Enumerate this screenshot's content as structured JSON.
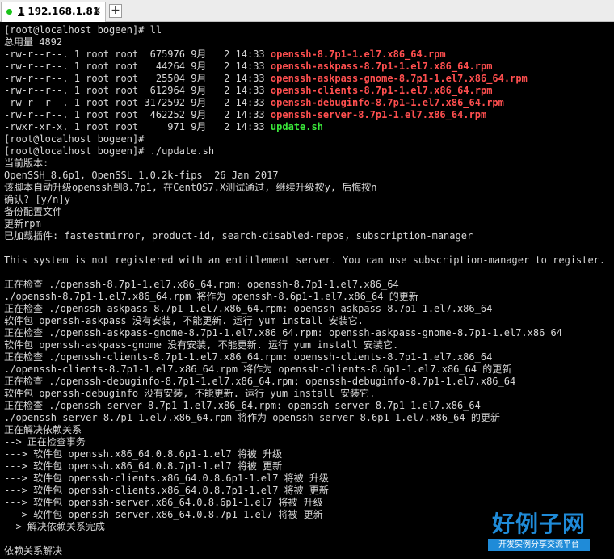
{
  "tab": {
    "number": "1",
    "host": "192.168.1.81",
    "close_glyph": "×",
    "status_color": "#19c319"
  },
  "new_tab_glyph": "+",
  "colors": {
    "default_text": "#d8d8d8",
    "rpm_file": "#ff4f4f",
    "script_file": "#3ae83a",
    "background": "#000000"
  },
  "terminal": {
    "lines": [
      [
        {
          "t": "[root@localhost bogeen]# ll"
        }
      ],
      [
        {
          "t": "总用量 4892"
        }
      ],
      [
        {
          "t": "-rw-r--r--. 1 root root  675976 9月   2 14:33 "
        },
        {
          "t": "openssh-8.7p1-1.el7.x86_64.rpm",
          "c": "rpm_file"
        }
      ],
      [
        {
          "t": "-rw-r--r--. 1 root root   44264 9月   2 14:33 "
        },
        {
          "t": "openssh-askpass-8.7p1-1.el7.x86_64.rpm",
          "c": "rpm_file"
        }
      ],
      [
        {
          "t": "-rw-r--r--. 1 root root   25504 9月   2 14:33 "
        },
        {
          "t": "openssh-askpass-gnome-8.7p1-1.el7.x86_64.rpm",
          "c": "rpm_file"
        }
      ],
      [
        {
          "t": "-rw-r--r--. 1 root root  612964 9月   2 14:33 "
        },
        {
          "t": "openssh-clients-8.7p1-1.el7.x86_64.rpm",
          "c": "rpm_file"
        }
      ],
      [
        {
          "t": "-rw-r--r--. 1 root root 3172592 9月   2 14:33 "
        },
        {
          "t": "openssh-debuginfo-8.7p1-1.el7.x86_64.rpm",
          "c": "rpm_file"
        }
      ],
      [
        {
          "t": "-rw-r--r--. 1 root root  462252 9月   2 14:33 "
        },
        {
          "t": "openssh-server-8.7p1-1.el7.x86_64.rpm",
          "c": "rpm_file"
        }
      ],
      [
        {
          "t": "-rwxr-xr-x. 1 root root     971 9月   2 14:33 "
        },
        {
          "t": "update.sh",
          "c": "script_file"
        }
      ],
      [
        {
          "t": "[root@localhost bogeen]#"
        }
      ],
      [
        {
          "t": "[root@localhost bogeen]# ./update.sh"
        }
      ],
      [
        {
          "t": "当前版本:"
        }
      ],
      [
        {
          "t": "OpenSSH_8.6p1, OpenSSL 1.0.2k-fips  26 Jan 2017"
        }
      ],
      [
        {
          "t": "该脚本自动升级openssh到8.7p1, 在CentOS7.X测试通过, 继续升级按y, 后悔按n"
        }
      ],
      [
        {
          "t": "确认? [y/n]y"
        }
      ],
      [
        {
          "t": "备份配置文件"
        }
      ],
      [
        {
          "t": "更新rpm"
        }
      ],
      [
        {
          "t": "已加载插件: fastestmirror, product-id, search-disabled-repos, subscription-manager"
        }
      ],
      [
        {
          "t": ""
        }
      ],
      [
        {
          "t": "This system is not registered with an entitlement server. You can use subscription-manager to register."
        }
      ],
      [
        {
          "t": ""
        }
      ],
      [
        {
          "t": "正在检查 ./openssh-8.7p1-1.el7.x86_64.rpm: openssh-8.7p1-1.el7.x86_64"
        }
      ],
      [
        {
          "t": "./openssh-8.7p1-1.el7.x86_64.rpm 将作为 openssh-8.6p1-1.el7.x86_64 的更新"
        }
      ],
      [
        {
          "t": "正在检查 ./openssh-askpass-8.7p1-1.el7.x86_64.rpm: openssh-askpass-8.7p1-1.el7.x86_64"
        }
      ],
      [
        {
          "t": "软件包 openssh-askpass 没有安装, 不能更新. 运行 yum install 安装它."
        }
      ],
      [
        {
          "t": "正在检查 ./openssh-askpass-gnome-8.7p1-1.el7.x86_64.rpm: openssh-askpass-gnome-8.7p1-1.el7.x86_64"
        }
      ],
      [
        {
          "t": "软件包 openssh-askpass-gnome 没有安装, 不能更新. 运行 yum install 安装它."
        }
      ],
      [
        {
          "t": "正在检查 ./openssh-clients-8.7p1-1.el7.x86_64.rpm: openssh-clients-8.7p1-1.el7.x86_64"
        }
      ],
      [
        {
          "t": "./openssh-clients-8.7p1-1.el7.x86_64.rpm 将作为 openssh-clients-8.6p1-1.el7.x86_64 的更新"
        }
      ],
      [
        {
          "t": "正在检查 ./openssh-debuginfo-8.7p1-1.el7.x86_64.rpm: openssh-debuginfo-8.7p1-1.el7.x86_64"
        }
      ],
      [
        {
          "t": "软件包 openssh-debuginfo 没有安装, 不能更新. 运行 yum install 安装它."
        }
      ],
      [
        {
          "t": "正在检查 ./openssh-server-8.7p1-1.el7.x86_64.rpm: openssh-server-8.7p1-1.el7.x86_64"
        }
      ],
      [
        {
          "t": "./openssh-server-8.7p1-1.el7.x86_64.rpm 将作为 openssh-server-8.6p1-1.el7.x86_64 的更新"
        }
      ],
      [
        {
          "t": "正在解决依赖关系"
        }
      ],
      [
        {
          "t": "--> 正在检查事务"
        }
      ],
      [
        {
          "t": "---> 软件包 openssh.x86_64.0.8.6p1-1.el7 将被 升级"
        }
      ],
      [
        {
          "t": "---> 软件包 openssh.x86_64.0.8.7p1-1.el7 将被 更新"
        }
      ],
      [
        {
          "t": "---> 软件包 openssh-clients.x86_64.0.8.6p1-1.el7 将被 升级"
        }
      ],
      [
        {
          "t": "---> 软件包 openssh-clients.x86_64.0.8.7p1-1.el7 将被 更新"
        }
      ],
      [
        {
          "t": "---> 软件包 openssh-server.x86_64.0.8.6p1-1.el7 将被 升级"
        }
      ],
      [
        {
          "t": "---> 软件包 openssh-server.x86_64.0.8.7p1-1.el7 将被 更新"
        }
      ],
      [
        {
          "t": "--> 解决依赖关系完成"
        }
      ],
      [
        {
          "t": ""
        }
      ],
      [
        {
          "t": "依赖关系解决"
        }
      ]
    ]
  },
  "watermark": {
    "title": "好例子网",
    "subtitle": "开发实例分享交流平台",
    "color": "#1f8bd8"
  }
}
